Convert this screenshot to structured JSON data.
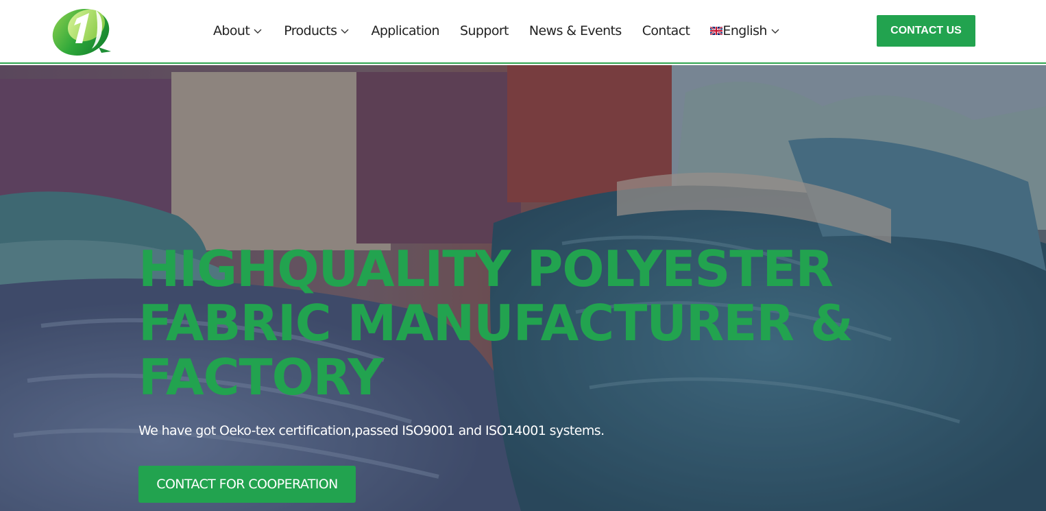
{
  "header": {
    "logo_icon": "brand-logo-icon",
    "nav": {
      "about": "About",
      "products": "Products",
      "application": "Application",
      "support": "Support",
      "news_events": "News & Events",
      "contact": "Contact",
      "language": "English"
    },
    "contact_button": "CONTACT US"
  },
  "hero": {
    "title_line1": "HIGHQUALITY POLYESTER",
    "title_line2": "FABRIC MANUFACTURER &",
    "title_line3": "FACTORY",
    "subtitle": "We have got Oeko-tex certification,passed ISO9001 and ISO14001 systems.",
    "cta_button": "CONTACT FOR COOPERATION"
  },
  "colors": {
    "brand_green": "#22a34f",
    "header_bg": "#ffffff",
    "nav_text": "#222222"
  },
  "icons": [
    "brand-logo-icon",
    "chevron-down-icon",
    "uk-flag-icon"
  ]
}
